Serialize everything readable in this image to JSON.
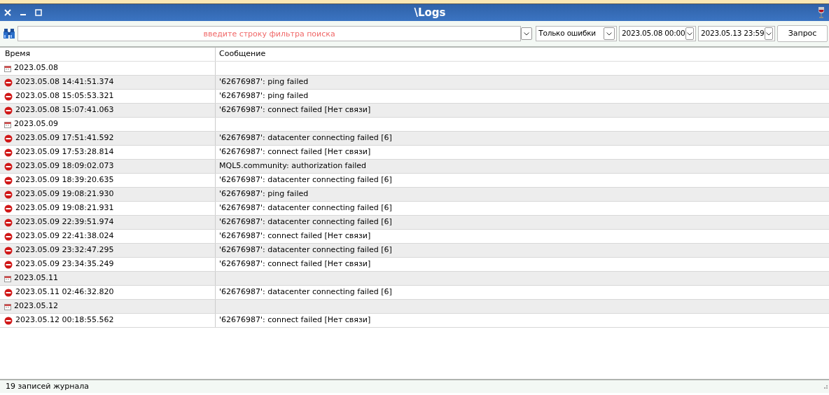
{
  "window": {
    "title": "\\Logs"
  },
  "toolbar": {
    "search": {
      "placeholder": "введите строку фильтра поиска"
    },
    "filter": "Только ошибки",
    "date_from": "2023.05.08 00:00",
    "date_to": "2023.05.13 23:59",
    "query_button": "Запрос"
  },
  "table": {
    "columns": [
      "Время",
      "Сообщение"
    ],
    "rows": [
      {
        "kind": "date",
        "time": "2023.05.08",
        "message": ""
      },
      {
        "kind": "error",
        "time": "2023.05.08 14:41:51.374",
        "message": "'62676987': ping failed"
      },
      {
        "kind": "error",
        "time": "2023.05.08 15:05:53.321",
        "message": "'62676987': ping failed"
      },
      {
        "kind": "error",
        "time": "2023.05.08 15:07:41.063",
        "message": "'62676987': connect failed [Нет связи]"
      },
      {
        "kind": "date",
        "time": "2023.05.09",
        "message": ""
      },
      {
        "kind": "error",
        "time": "2023.05.09 17:51:41.592",
        "message": "'62676987': datacenter connecting failed [6]"
      },
      {
        "kind": "error",
        "time": "2023.05.09 17:53:28.814",
        "message": "'62676987': connect failed [Нет связи]"
      },
      {
        "kind": "error",
        "time": "2023.05.09 18:09:02.073",
        "message": "MQL5.community: authorization failed"
      },
      {
        "kind": "error",
        "time": "2023.05.09 18:39:20.635",
        "message": "'62676987': datacenter connecting failed [6]"
      },
      {
        "kind": "error",
        "time": "2023.05.09 19:08:21.930",
        "message": "'62676987': ping failed"
      },
      {
        "kind": "error",
        "time": "2023.05.09 19:08:21.931",
        "message": "'62676987': datacenter connecting failed [6]"
      },
      {
        "kind": "error",
        "time": "2023.05.09 22:39:51.974",
        "message": "'62676987': datacenter connecting failed [6]"
      },
      {
        "kind": "error",
        "time": "2023.05.09 22:41:38.024",
        "message": "'62676987': connect failed [Нет связи]"
      },
      {
        "kind": "error",
        "time": "2023.05.09 23:32:47.295",
        "message": "'62676987': datacenter connecting failed [6]"
      },
      {
        "kind": "error",
        "time": "2023.05.09 23:34:35.249",
        "message": "'62676987': connect failed [Нет связи]"
      },
      {
        "kind": "date",
        "time": "2023.05.11",
        "message": ""
      },
      {
        "kind": "error",
        "time": "2023.05.11 02:46:32.820",
        "message": "'62676987': datacenter connecting failed [6]"
      },
      {
        "kind": "date",
        "time": "2023.05.12",
        "message": ""
      },
      {
        "kind": "error",
        "time": "2023.05.12 00:18:55.562",
        "message": "'62676987': connect failed [Нет связи]"
      }
    ]
  },
  "status_bar": "19 записей журнала"
}
